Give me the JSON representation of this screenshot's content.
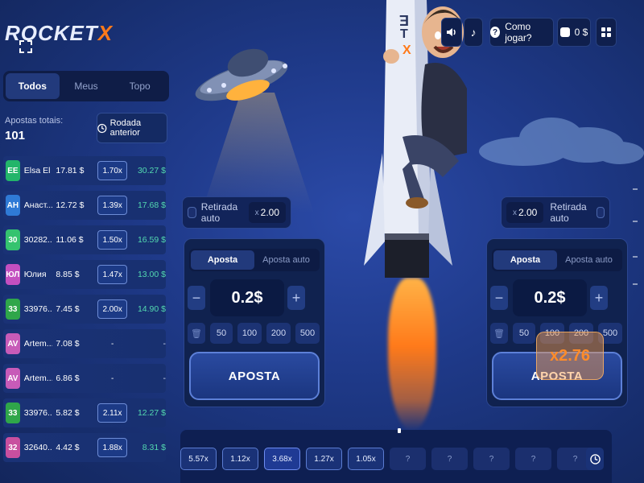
{
  "logo": {
    "text_main": "ROCKET",
    "text_accent": "X"
  },
  "topbar": {
    "how_to_play": "Como jogar?",
    "balance": "0 $"
  },
  "left": {
    "tabs": [
      "Todos",
      "Meus",
      "Topo"
    ],
    "active_tab": "Todos",
    "totals_label": "Apostas totais:",
    "totals_value": "101",
    "prev_round": "Rodada anterior",
    "bets": [
      {
        "initials": "EE",
        "color": "#23b56a",
        "name": "Elsa El",
        "amount": "17.81 $",
        "mult": "1.70x",
        "win": "30.27 $"
      },
      {
        "initials": "АН",
        "color": "#2f7ad6",
        "name": "Анаст...",
        "amount": "12.72 $",
        "mult": "1.39x",
        "win": "17.68 $"
      },
      {
        "initials": "30",
        "color": "#35c36f",
        "name": "30282...",
        "amount": "11.06 $",
        "mult": "1.50x",
        "win": "16.59 $"
      },
      {
        "initials": "ЮЛ",
        "color": "#c34fc0",
        "name": "Юлия",
        "amount": "8.85 $",
        "mult": "1.47x",
        "win": "13.00 $"
      },
      {
        "initials": "33",
        "color": "#2fa64a",
        "name": "33976...",
        "amount": "7.45 $",
        "mult": "2.00x",
        "win": "14.90 $"
      },
      {
        "initials": "AV",
        "color": "#c75bb8",
        "name": "Artem...",
        "amount": "7.08 $",
        "mult": "-",
        "win": "-"
      },
      {
        "initials": "AV",
        "color": "#c75bb8",
        "name": "Artem...",
        "amount": "6.86 $",
        "mult": "-",
        "win": "-"
      },
      {
        "initials": "33",
        "color": "#2fa64a",
        "name": "33976...",
        "amount": "5.82 $",
        "mult": "2.11x",
        "win": "12.27 $"
      },
      {
        "initials": "32",
        "color": "#c84f9f",
        "name": "32640...",
        "amount": "4.42 $",
        "mult": "1.88x",
        "win": "8.31 $"
      }
    ]
  },
  "panel_left": {
    "auto_label": "Retirada auto",
    "auto_value": "2.00",
    "auto_prefix": "x",
    "tab_bet": "Aposta",
    "tab_auto": "Aposta auto",
    "stake": "0.2$",
    "quick": [
      "50",
      "100",
      "200",
      "500"
    ],
    "button": "APOSTA"
  },
  "panel_right": {
    "auto_label": "Retirada auto",
    "auto_value": "2.00",
    "auto_prefix": "x",
    "tab_bet": "Aposta",
    "tab_auto": "Aposta auto",
    "stake": "0.2$",
    "quick": [
      "50",
      "100",
      "200",
      "500"
    ],
    "button": "APOSTA"
  },
  "multiplier": "x2.76",
  "side_marker": "4",
  "history": [
    "5.57x",
    "1.12x",
    "3.68x",
    "1.27x",
    "1.05x",
    "?",
    "?",
    "?",
    "?",
    "?"
  ],
  "rocket_letters": [
    "E",
    "T",
    "X"
  ]
}
